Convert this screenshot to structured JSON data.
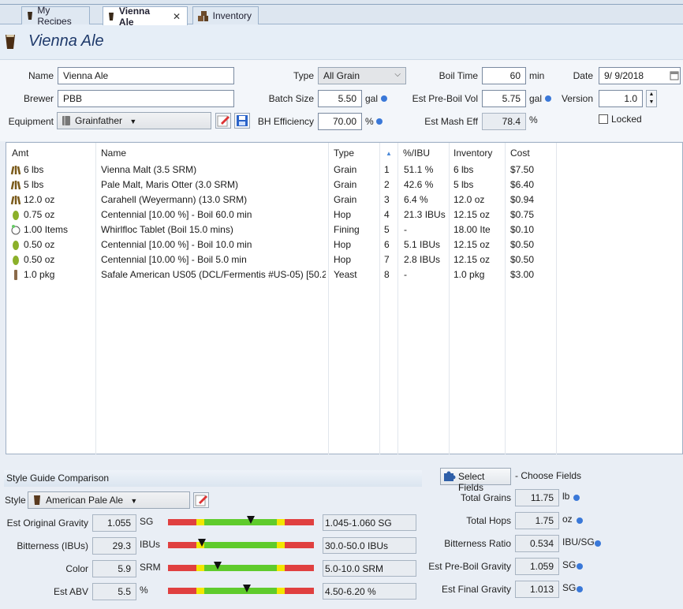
{
  "tabs": [
    {
      "label": "My Recipes",
      "active": false
    },
    {
      "label": "Vienna Ale",
      "active": true,
      "close": "✕"
    },
    {
      "label": "Inventory",
      "active": false
    }
  ],
  "recipe_title": "Vienna Ale",
  "form": {
    "name_label": "Name",
    "name_value": "Vienna Ale",
    "brewer_label": "Brewer",
    "brewer_value": "PBB",
    "equipment_label": "Equipment",
    "equipment_value": "Grainfather",
    "type_label": "Type",
    "type_value": "All Grain",
    "batch_label": "Batch Size",
    "batch_value": "5.50",
    "batch_unit": "gal",
    "bh_label": "BH Efficiency",
    "bh_value": "70.00",
    "bh_unit": "%",
    "boil_time_label": "Boil Time",
    "boil_time_value": "60",
    "boil_time_unit": "min",
    "preboil_label": "Est Pre-Boil Vol",
    "preboil_value": "5.75",
    "preboil_unit": "gal",
    "mash_eff_label": "Est Mash Eff",
    "mash_eff_value": "78.4",
    "mash_eff_unit": "%",
    "date_label": "Date",
    "date_value": "9/  9/2018",
    "version_label": "Version",
    "version_value": "1.0",
    "locked_label": "Locked",
    "locked_checked": false
  },
  "table": {
    "headers": {
      "amt": "Amt",
      "name": "Name",
      "type": "Type",
      "sort": "▲",
      "ibu": "%/IBU",
      "inventory": "Inventory",
      "cost": "Cost"
    },
    "rows": [
      {
        "icon": "grain-icon",
        "amt": "6 lbs",
        "name": "Vienna Malt (3.5 SRM)",
        "type": "Grain",
        "num": "1",
        "ibu": "51.1 %",
        "inventory": "6 lbs",
        "cost": "$7.50"
      },
      {
        "icon": "grain-icon",
        "amt": "5 lbs",
        "name": "Pale Malt, Maris Otter (3.0 SRM)",
        "type": "Grain",
        "num": "2",
        "ibu": "42.6 %",
        "inventory": "5 lbs",
        "cost": "$6.40"
      },
      {
        "icon": "grain-icon",
        "amt": "12.0 oz",
        "name": "Carahell (Weyermann) (13.0 SRM)",
        "type": "Grain",
        "num": "3",
        "ibu": "6.4 %",
        "inventory": "12.0 oz",
        "cost": "$0.94"
      },
      {
        "icon": "hop-icon",
        "amt": "0.75 oz",
        "name": "Centennial [10.00 %] - Boil 60.0 min",
        "type": "Hop",
        "num": "4",
        "ibu": "21.3 IBUs",
        "inventory": "12.15 oz",
        "cost": "$0.75"
      },
      {
        "icon": "fining-icon",
        "amt": "1.00 Items",
        "name": "Whirlfloc Tablet (Boil 15.0 mins)",
        "type": "Fining",
        "num": "5",
        "ibu": "-",
        "inventory": "18.00 Ite",
        "cost": "$0.10"
      },
      {
        "icon": "hop-icon",
        "amt": "0.50 oz",
        "name": "Centennial [10.00 %] - Boil 10.0 min",
        "type": "Hop",
        "num": "6",
        "ibu": "5.1 IBUs",
        "inventory": "12.15 oz",
        "cost": "$0.50"
      },
      {
        "icon": "hop-icon",
        "amt": "0.50 oz",
        "name": "Centennial [10.00 %] - Boil 5.0 min",
        "type": "Hop",
        "num": "7",
        "ibu": "2.8 IBUs",
        "inventory": "12.15 oz",
        "cost": "$0.50"
      },
      {
        "icon": "yeast-icon",
        "amt": "1.0 pkg",
        "name": "Safale American US05 (DCL/Fermentis #US-05) [50.2…",
        "type": "Yeast",
        "num": "8",
        "ibu": "-",
        "inventory": "1.0 pkg",
        "cost": "$3.00"
      }
    ]
  },
  "style_guide": {
    "header": "Style Guide Comparison",
    "style_label": "Style",
    "style_value": "American Pale Ale",
    "metrics": [
      {
        "label": "Est Original Gravity",
        "value": "1.055",
        "unit": "SG",
        "range": "1.045-1.060 SG",
        "marker_fraction": 0.57
      },
      {
        "label": "Bitterness (IBUs)",
        "value": "29.3",
        "unit": "IBUs",
        "range": "30.0-50.0 IBUs",
        "marker_fraction": 0.23
      },
      {
        "label": "Color",
        "value": "5.9",
        "unit": "SRM",
        "range": "5.0-10.0 SRM",
        "marker_fraction": 0.34
      },
      {
        "label": "Est ABV",
        "value": "5.5",
        "unit": "%",
        "range": "4.50-6.20 %",
        "marker_fraction": 0.54
      }
    ]
  },
  "fields": {
    "select_label": "Select Fields",
    "choose_label": "- Choose Fields",
    "items": [
      {
        "label": "Total Grains",
        "value": "11.75",
        "unit": "lb"
      },
      {
        "label": "Total Hops",
        "value": "1.75",
        "unit": "oz"
      },
      {
        "label": "Bitterness Ratio",
        "value": "0.534",
        "unit": "IBU/SG"
      },
      {
        "label": "Est Pre-Boil Gravity",
        "value": "1.059",
        "unit": "SG"
      },
      {
        "label": "Est Final Gravity",
        "value": "1.013",
        "unit": "SG"
      }
    ]
  },
  "colors": {
    "accent": "#3a78d8",
    "bar_red": "#e04040",
    "bar_yellow": "#f2e600",
    "bar_green": "#5fcb2c"
  }
}
